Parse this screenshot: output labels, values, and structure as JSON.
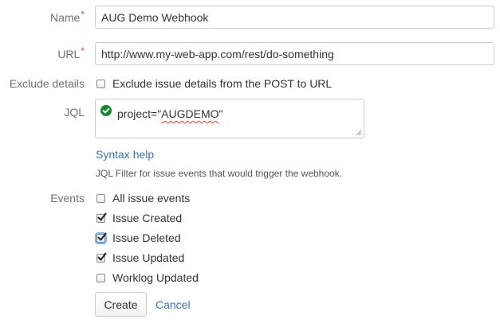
{
  "form": {
    "name": {
      "label": "Name",
      "required_marker": "*",
      "value": "AUG Demo Webhook"
    },
    "url": {
      "label": "URL",
      "required_marker": "*",
      "value": "http://www.my-web-app.com/rest/do-something"
    },
    "exclude_details": {
      "label": "Exclude details",
      "checkbox_label": "Exclude issue details from the POST to URL",
      "checked": false
    },
    "jql": {
      "label": "JQL",
      "value_prefix": "project=\"",
      "value_highlight": "AUGDEMO",
      "value_suffix": "\"",
      "status_icon": "check-circle-icon",
      "syntax_help": "Syntax help",
      "description": "JQL Filter for issue events that would trigger the webhook."
    },
    "events": {
      "label": "Events",
      "options": [
        {
          "label": "All issue events",
          "checked": false
        },
        {
          "label": "Issue Created",
          "checked": true
        },
        {
          "label": "Issue Deleted",
          "checked": true
        },
        {
          "label": "Issue Updated",
          "checked": true
        },
        {
          "label": "Worklog Updated",
          "checked": false
        }
      ]
    },
    "actions": {
      "create_label": "Create",
      "cancel_label": "Cancel"
    }
  },
  "colors": {
    "link": "#3b73af",
    "required": "#d04437",
    "valid": "#14892c"
  }
}
